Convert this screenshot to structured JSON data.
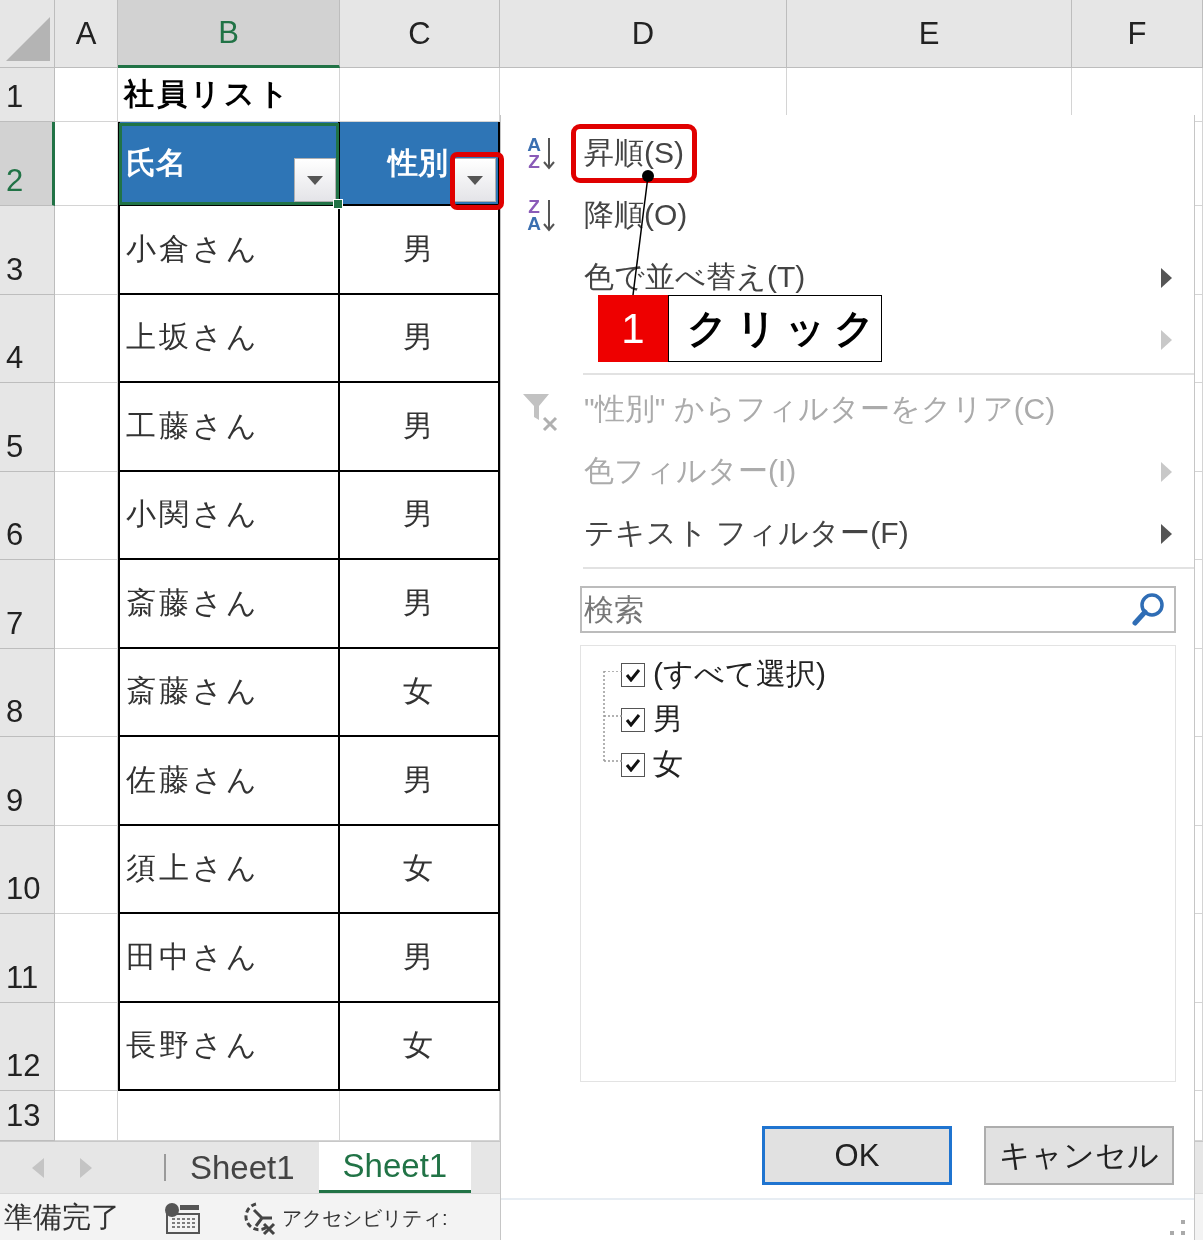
{
  "sheet": {
    "columns": [
      {
        "label": "A",
        "selected": false
      },
      {
        "label": "B",
        "selected": true
      },
      {
        "label": "C",
        "selected": false
      },
      {
        "label": "D",
        "selected": false
      },
      {
        "label": "E",
        "selected": false
      },
      {
        "label": "F",
        "selected": false
      }
    ],
    "rows": [
      {
        "label": "1",
        "selected": false
      },
      {
        "label": "2",
        "selected": true
      },
      {
        "label": "3",
        "selected": false
      },
      {
        "label": "4",
        "selected": false
      },
      {
        "label": "5",
        "selected": false
      },
      {
        "label": "6",
        "selected": false
      },
      {
        "label": "7",
        "selected": false
      },
      {
        "label": "8",
        "selected": false
      },
      {
        "label": "9",
        "selected": false
      },
      {
        "label": "10",
        "selected": false
      },
      {
        "label": "11",
        "selected": false
      },
      {
        "label": "12",
        "selected": false
      },
      {
        "label": "13",
        "selected": false
      }
    ],
    "title": "社員リスト",
    "table": {
      "headers": [
        {
          "label": "氏名",
          "selected": true,
          "highlighted": false
        },
        {
          "label": "性別",
          "selected": false,
          "highlighted": true
        }
      ],
      "rows": [
        {
          "cells": [
            "小倉さん",
            "男"
          ]
        },
        {
          "cells": [
            "上坂さん",
            "男"
          ]
        },
        {
          "cells": [
            "工藤さん",
            "男"
          ]
        },
        {
          "cells": [
            "小関さん",
            "男"
          ]
        },
        {
          "cells": [
            "斎藤さん",
            "男"
          ]
        },
        {
          "cells": [
            "斎藤さん",
            "女"
          ]
        },
        {
          "cells": [
            "佐藤さん",
            "男"
          ]
        },
        {
          "cells": [
            "須上さん",
            "女"
          ]
        },
        {
          "cells": [
            "田中さん",
            "男"
          ]
        },
        {
          "cells": [
            "長野さん",
            "女"
          ]
        }
      ]
    }
  },
  "sheet_tabs": [
    {
      "label": "Sheet1",
      "selected": false
    },
    {
      "label": "Sheet1",
      "selected": true
    }
  ],
  "status_bar": {
    "ready": "準備完了",
    "accessibility": "アクセシビリティ:"
  },
  "filter_menu": {
    "items": [
      {
        "kind": "ascending",
        "letters": [
          "A",
          "Z"
        ],
        "label": "昇順(S)",
        "disabled": false,
        "highlighted": true
      },
      {
        "kind": "descending",
        "letters": [
          "Z",
          "A"
        ],
        "label": "降順(O)",
        "disabled": false,
        "highlighted": false
      },
      {
        "kind": "submenu",
        "label": "色で並べ替え(T)",
        "disabled": false
      },
      {
        "kind": "submenu",
        "disabled": true
      },
      {
        "kind": "separator"
      },
      {
        "kind": "clear",
        "label": "\"性別\" からフィルターをクリア(C)",
        "disabled": true
      },
      {
        "kind": "submenu",
        "label": "色フィルター(I)",
        "disabled": true
      },
      {
        "kind": "submenu",
        "label": "テキスト フィルター(F)",
        "disabled": false
      },
      {
        "kind": "separator"
      }
    ],
    "search": {
      "placeholder": "検索"
    },
    "values": [
      {
        "label": "(すべて選択)",
        "checked": true
      },
      {
        "label": "男",
        "checked": true
      },
      {
        "label": "女",
        "checked": true
      }
    ],
    "buttons": [
      {
        "label": "OK",
        "default": true
      },
      {
        "label": "キャンセル",
        "default": false
      }
    ]
  },
  "callout": {
    "step": "1",
    "text": "クリック"
  }
}
